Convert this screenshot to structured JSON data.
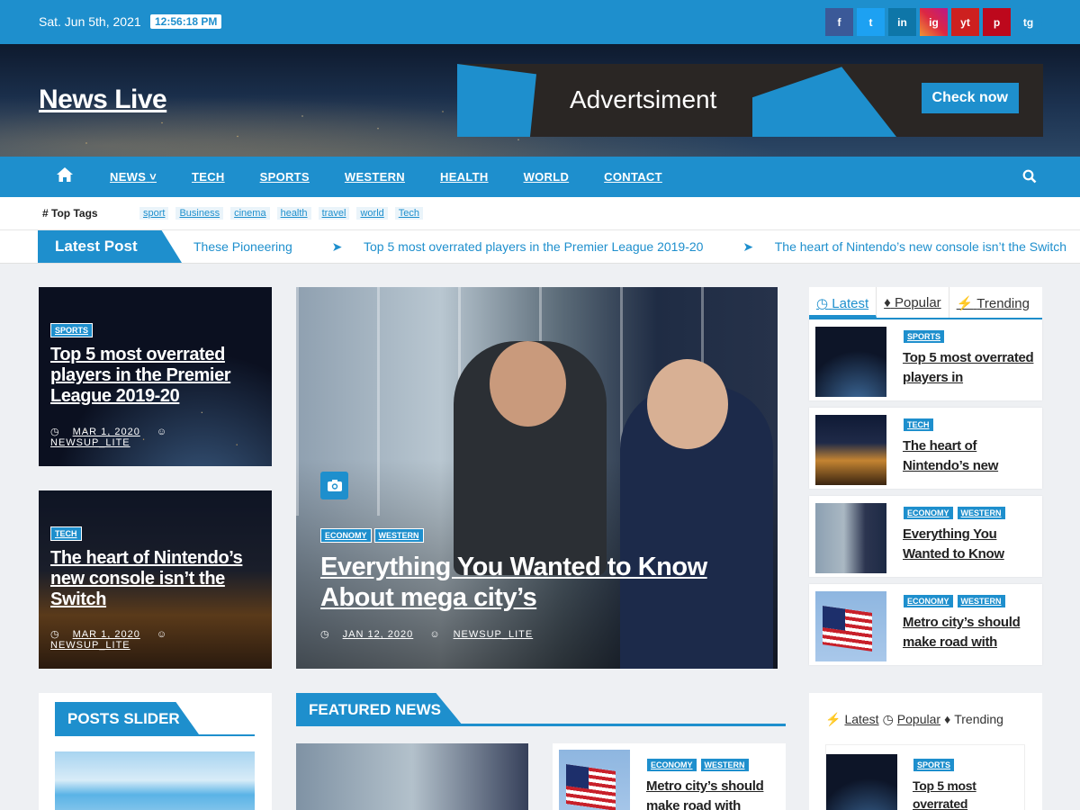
{
  "topbar": {
    "date": "Sat. Jun 5th, 2021",
    "time": "12:56:18 PM",
    "social": [
      {
        "icon": "facebook-icon",
        "glyph": "f",
        "color": "#3b5998"
      },
      {
        "icon": "twitter-icon",
        "glyph": "t",
        "color": "#1da1f2"
      },
      {
        "icon": "linkedin-icon",
        "glyph": "in",
        "color": "#0e76a8"
      },
      {
        "icon": "instagram-icon",
        "glyph": "ig",
        "color": "#c13584"
      },
      {
        "icon": "youtube-icon",
        "glyph": "yt",
        "color": "#cd201f"
      },
      {
        "icon": "pinterest-icon",
        "glyph": "p",
        "color": "#bd081c"
      },
      {
        "icon": "telegram-icon",
        "glyph": "tg",
        "color": "#1e8fcd"
      }
    ]
  },
  "header": {
    "logo": "News Live",
    "ad_text": "Advertsiment",
    "ad_button": "Check now"
  },
  "nav": {
    "items": [
      "NEWS",
      "TECH",
      "SPORTS",
      "WESTERN",
      "HEALTH",
      "WORLD",
      "CONTACT"
    ]
  },
  "tags": {
    "label": "Top Tags",
    "items": [
      "sport",
      "Business",
      "cinema",
      "health",
      "travel",
      "world",
      "Tech"
    ]
  },
  "ticker": {
    "label": "Latest Post",
    "items": [
      "These Pioneering",
      "Top 5 most overrated players in the Premier League 2019-20",
      "The heart of Nintendo’s new console isn’t the Switch"
    ]
  },
  "left_cards": [
    {
      "category": "SPORTS",
      "title": "Top 5 most overrated players in the Premier League 2019-20",
      "date": "MAR 1, 2020",
      "author": "NEWSUP_LITE"
    },
    {
      "category": "TECH",
      "title": "The heart of Nintendo’s new console isn’t the Switch",
      "date": "MAR 1, 2020",
      "author": "NEWSUP_LITE"
    }
  ],
  "feature": {
    "categories": [
      "ECONOMY",
      "WESTERN"
    ],
    "title": "Everything You Wanted to Know About mega city’s",
    "date": "JAN 12, 2020",
    "author": "NEWSUP_LITE"
  },
  "right_tabs": {
    "tabs": [
      "Latest",
      "Popular",
      "Trending"
    ],
    "items": [
      {
        "categories": [
          "SPORTS"
        ],
        "title": "Top 5 most overrated players in"
      },
      {
        "categories": [
          "TECH"
        ],
        "title": "The heart of Nintendo’s new"
      },
      {
        "categories": [
          "ECONOMY",
          "WESTERN"
        ],
        "title": "Everything You Wanted to Know"
      },
      {
        "categories": [
          "ECONOMY",
          "WESTERN"
        ],
        "title": "Metro city’s should make road with"
      }
    ]
  },
  "bottom": {
    "slider_title": "POSTS SLIDER",
    "featured_title": "FEATURED NEWS",
    "featured_card": {
      "categories": [
        "ECONOMY",
        "WESTERN"
      ],
      "title": "Metro city’s should make road with"
    },
    "right_tabs": [
      "Latest",
      "Popular",
      "Trending"
    ],
    "right_item": {
      "category": "SPORTS",
      "title": "Top 5 most overrated"
    }
  },
  "colors": {
    "accent": "#1e8fcd"
  }
}
